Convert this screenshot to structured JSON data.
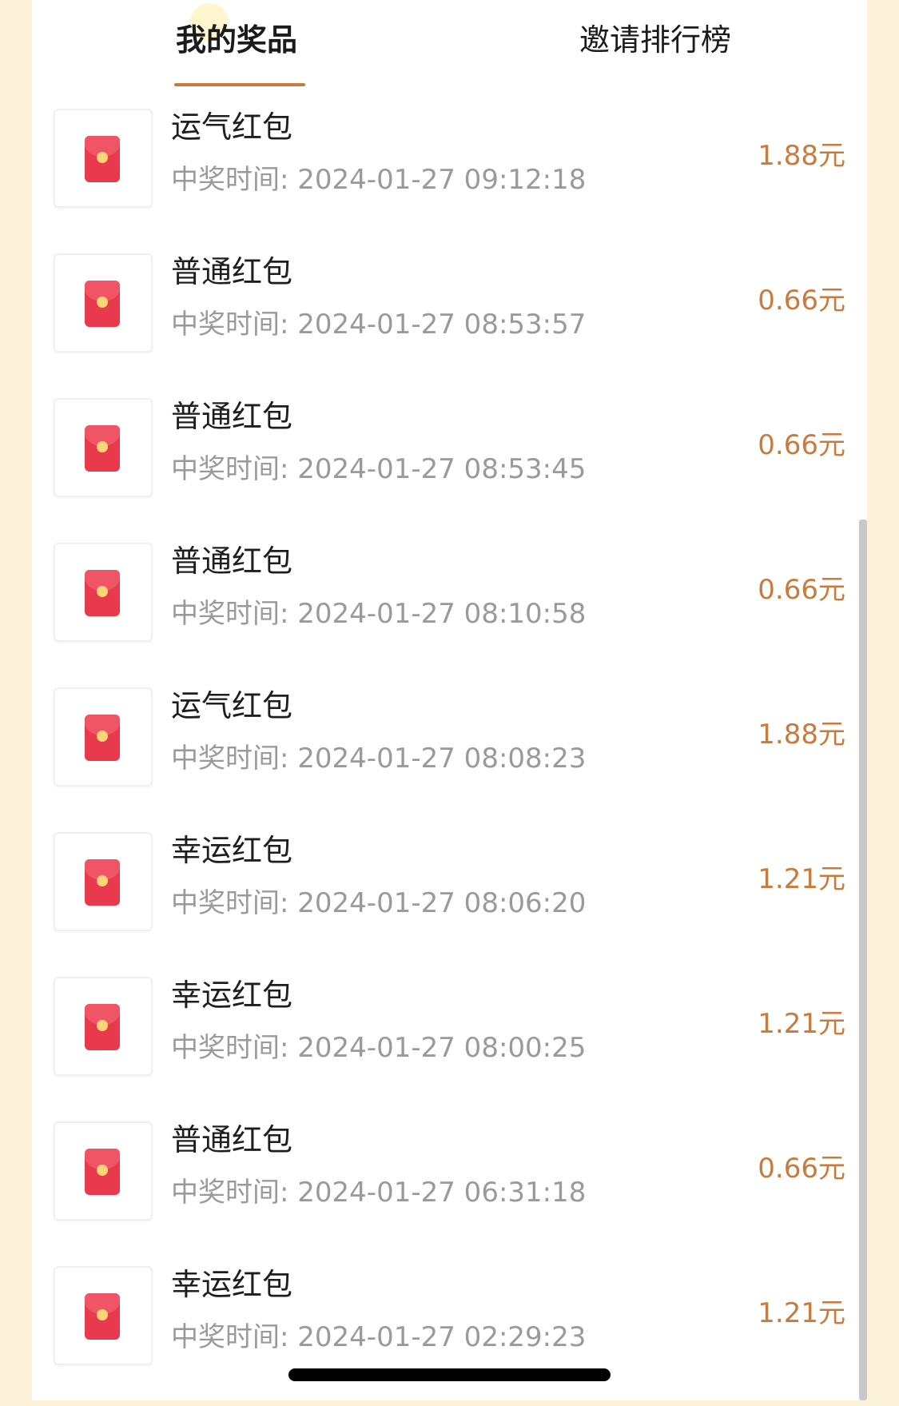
{
  "tabs": {
    "prizes": "我的奖品",
    "ranking": "邀请排行榜"
  },
  "time_label": "中奖时间:",
  "items": [
    {
      "name": "运气红包",
      "time": "2024-01-27 09:12:18",
      "amount": "1.88元"
    },
    {
      "name": "普通红包",
      "time": "2024-01-27 08:53:57",
      "amount": "0.66元"
    },
    {
      "name": "普通红包",
      "time": "2024-01-27 08:53:45",
      "amount": "0.66元"
    },
    {
      "name": "普通红包",
      "time": "2024-01-27 08:10:58",
      "amount": "0.66元"
    },
    {
      "name": "运气红包",
      "time": "2024-01-27 08:08:23",
      "amount": "1.88元"
    },
    {
      "name": "幸运红包",
      "time": "2024-01-27 08:06:20",
      "amount": "1.21元"
    },
    {
      "name": "幸运红包",
      "time": "2024-01-27 08:00:25",
      "amount": "1.21元"
    },
    {
      "name": "普通红包",
      "time": "2024-01-27 06:31:18",
      "amount": "0.66元"
    },
    {
      "name": "幸运红包",
      "time": "2024-01-27 02:29:23",
      "amount": "1.21元"
    }
  ],
  "colors": {
    "accent": "#c97b3e",
    "envelope": "#e8394d",
    "background": "#fdf3db"
  },
  "icons": {
    "prize": "red-envelope-icon"
  }
}
